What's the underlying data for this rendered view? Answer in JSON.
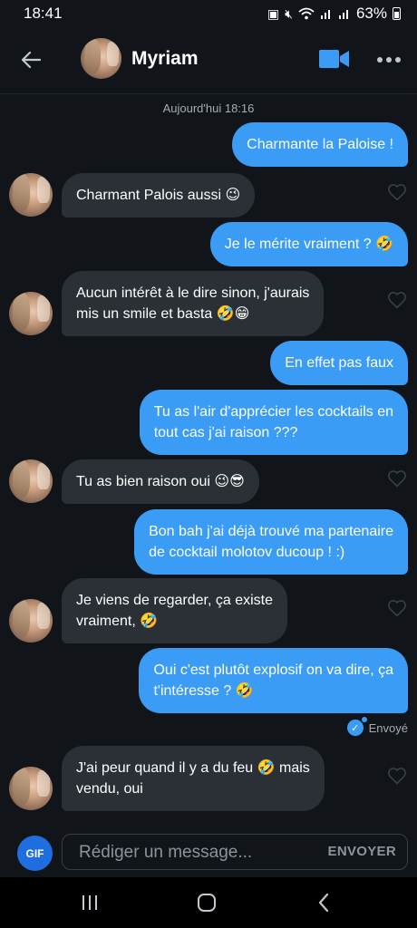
{
  "status_bar": {
    "time": "18:41",
    "battery": "63%",
    "icons": [
      "notification-icon",
      "mute-icon",
      "wifi-icon",
      "signal-icon",
      "signal-icon",
      "battery-icon"
    ]
  },
  "header": {
    "contact_name": "Myriam",
    "back_icon": "back-arrow-icon",
    "video_icon": "video-camera-icon",
    "more_icon": "more-dots-icon"
  },
  "chat": {
    "day_separator": "Aujourd'hui 18:16",
    "messages": [
      {
        "direction": "out",
        "text": "Charmante la Paloise !"
      },
      {
        "direction": "in",
        "text": "Charmant Palois aussi 😉"
      },
      {
        "direction": "out",
        "text": "Je le mérite vraiment ? 🤣"
      },
      {
        "direction": "in",
        "text": "Aucun intérêt à le dire sinon, j'aurais\nmis un smile et basta 🤣😁"
      },
      {
        "direction": "out",
        "text": "En effet pas faux"
      },
      {
        "direction": "out",
        "text": "Tu as l'air d'apprécier les cocktails en\ntout cas j'ai raison ???"
      },
      {
        "direction": "in",
        "text": "Tu as bien raison oui 😉😎"
      },
      {
        "direction": "out",
        "text": "Bon bah j'ai déjà trouvé ma partenaire\nde cocktail molotov ducoup ! :)"
      },
      {
        "direction": "in",
        "text": "Je viens de regarder, ça existe\nvraiment, 🤣"
      },
      {
        "direction": "out",
        "text": "Oui c'est plutôt explosif on va dire, ça\nt'intéresse ? 🤣"
      },
      {
        "direction": "in",
        "text": "J'ai peur quand il y a du feu 🤣 mais\nvendu, oui"
      }
    ],
    "sent_status": "Envoyé"
  },
  "composer": {
    "gif_label": "GIF",
    "placeholder": "Rédiger un message...",
    "send_label": "ENVOYER"
  },
  "navbar": {
    "icons": [
      "recent-apps-icon",
      "home-icon",
      "back-icon"
    ]
  },
  "colors": {
    "background": "#111418",
    "outgoing_bubble": "#3b9cf6",
    "incoming_bubble": "#2b2f36",
    "accent": "#1e6ee0"
  }
}
